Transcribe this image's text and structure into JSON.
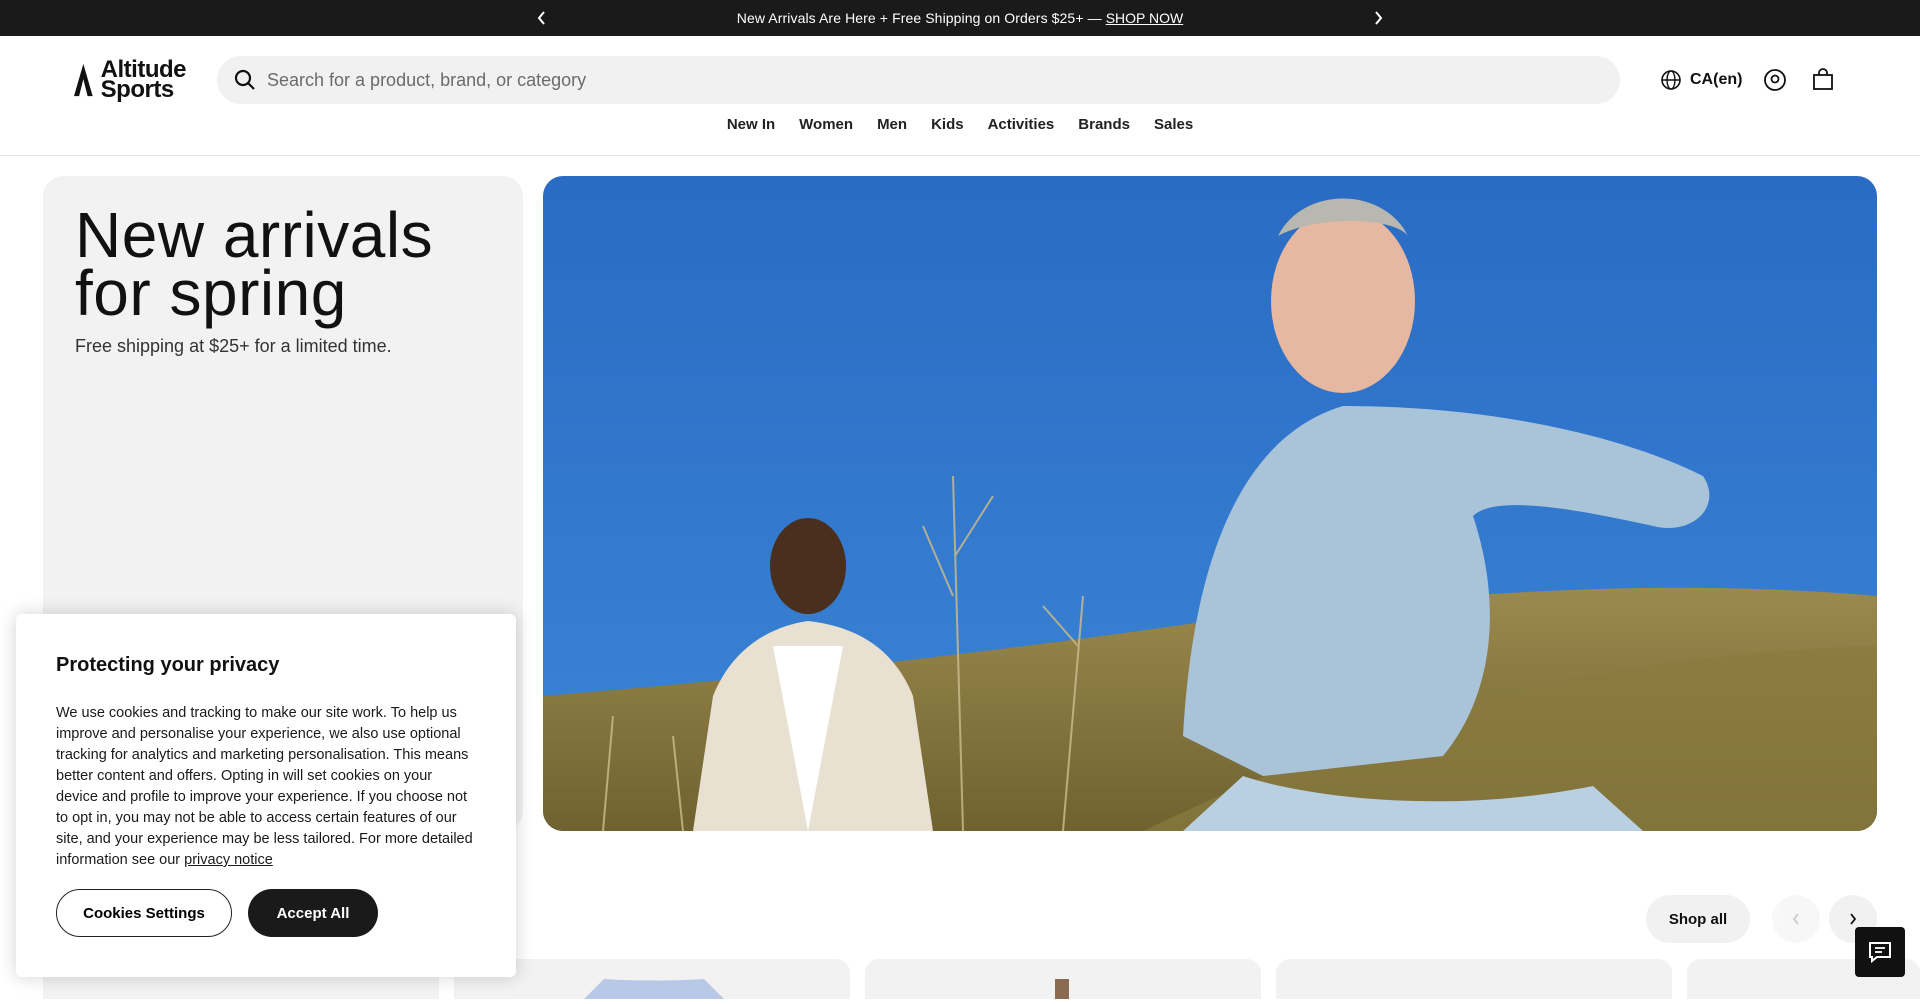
{
  "announcement": {
    "message": "New Arrivals Are Here + Free Shipping on Orders $25+ —",
    "cta": "SHOP NOW"
  },
  "header": {
    "logo_line1": "Altitude",
    "logo_line2": "Sports",
    "search_placeholder": "Search for a product, brand, or category",
    "locale": "CA(en)"
  },
  "nav": {
    "items": [
      "New In",
      "Women",
      "Men",
      "Kids",
      "Activities",
      "Brands",
      "Sales"
    ]
  },
  "hero": {
    "title": "New arrivals for spring",
    "subtitle": "Free shipping at $25+ for a limited time."
  },
  "products": {
    "shop_all": "Shop all"
  },
  "cookie": {
    "title": "Protecting your privacy",
    "body": "We use cookies and tracking to make our site work. To help us improve and personalise your experience, we also use optional tracking for analytics and marketing personalisation. This means better content and offers. Opting in will set cookies on your device and profile to improve your experience. If you choose not to opt in, you may not be able to access certain features of our site, and your experience may be less tailored. For more detailed information see our",
    "link": "privacy notice",
    "settings_label": "Cookies Settings",
    "accept_label": "Accept All"
  },
  "colors": {
    "announcement_bg": "#1a1a1a",
    "hero_panel_bg": "#f2f2f2",
    "sky": "#2e6fc4"
  }
}
